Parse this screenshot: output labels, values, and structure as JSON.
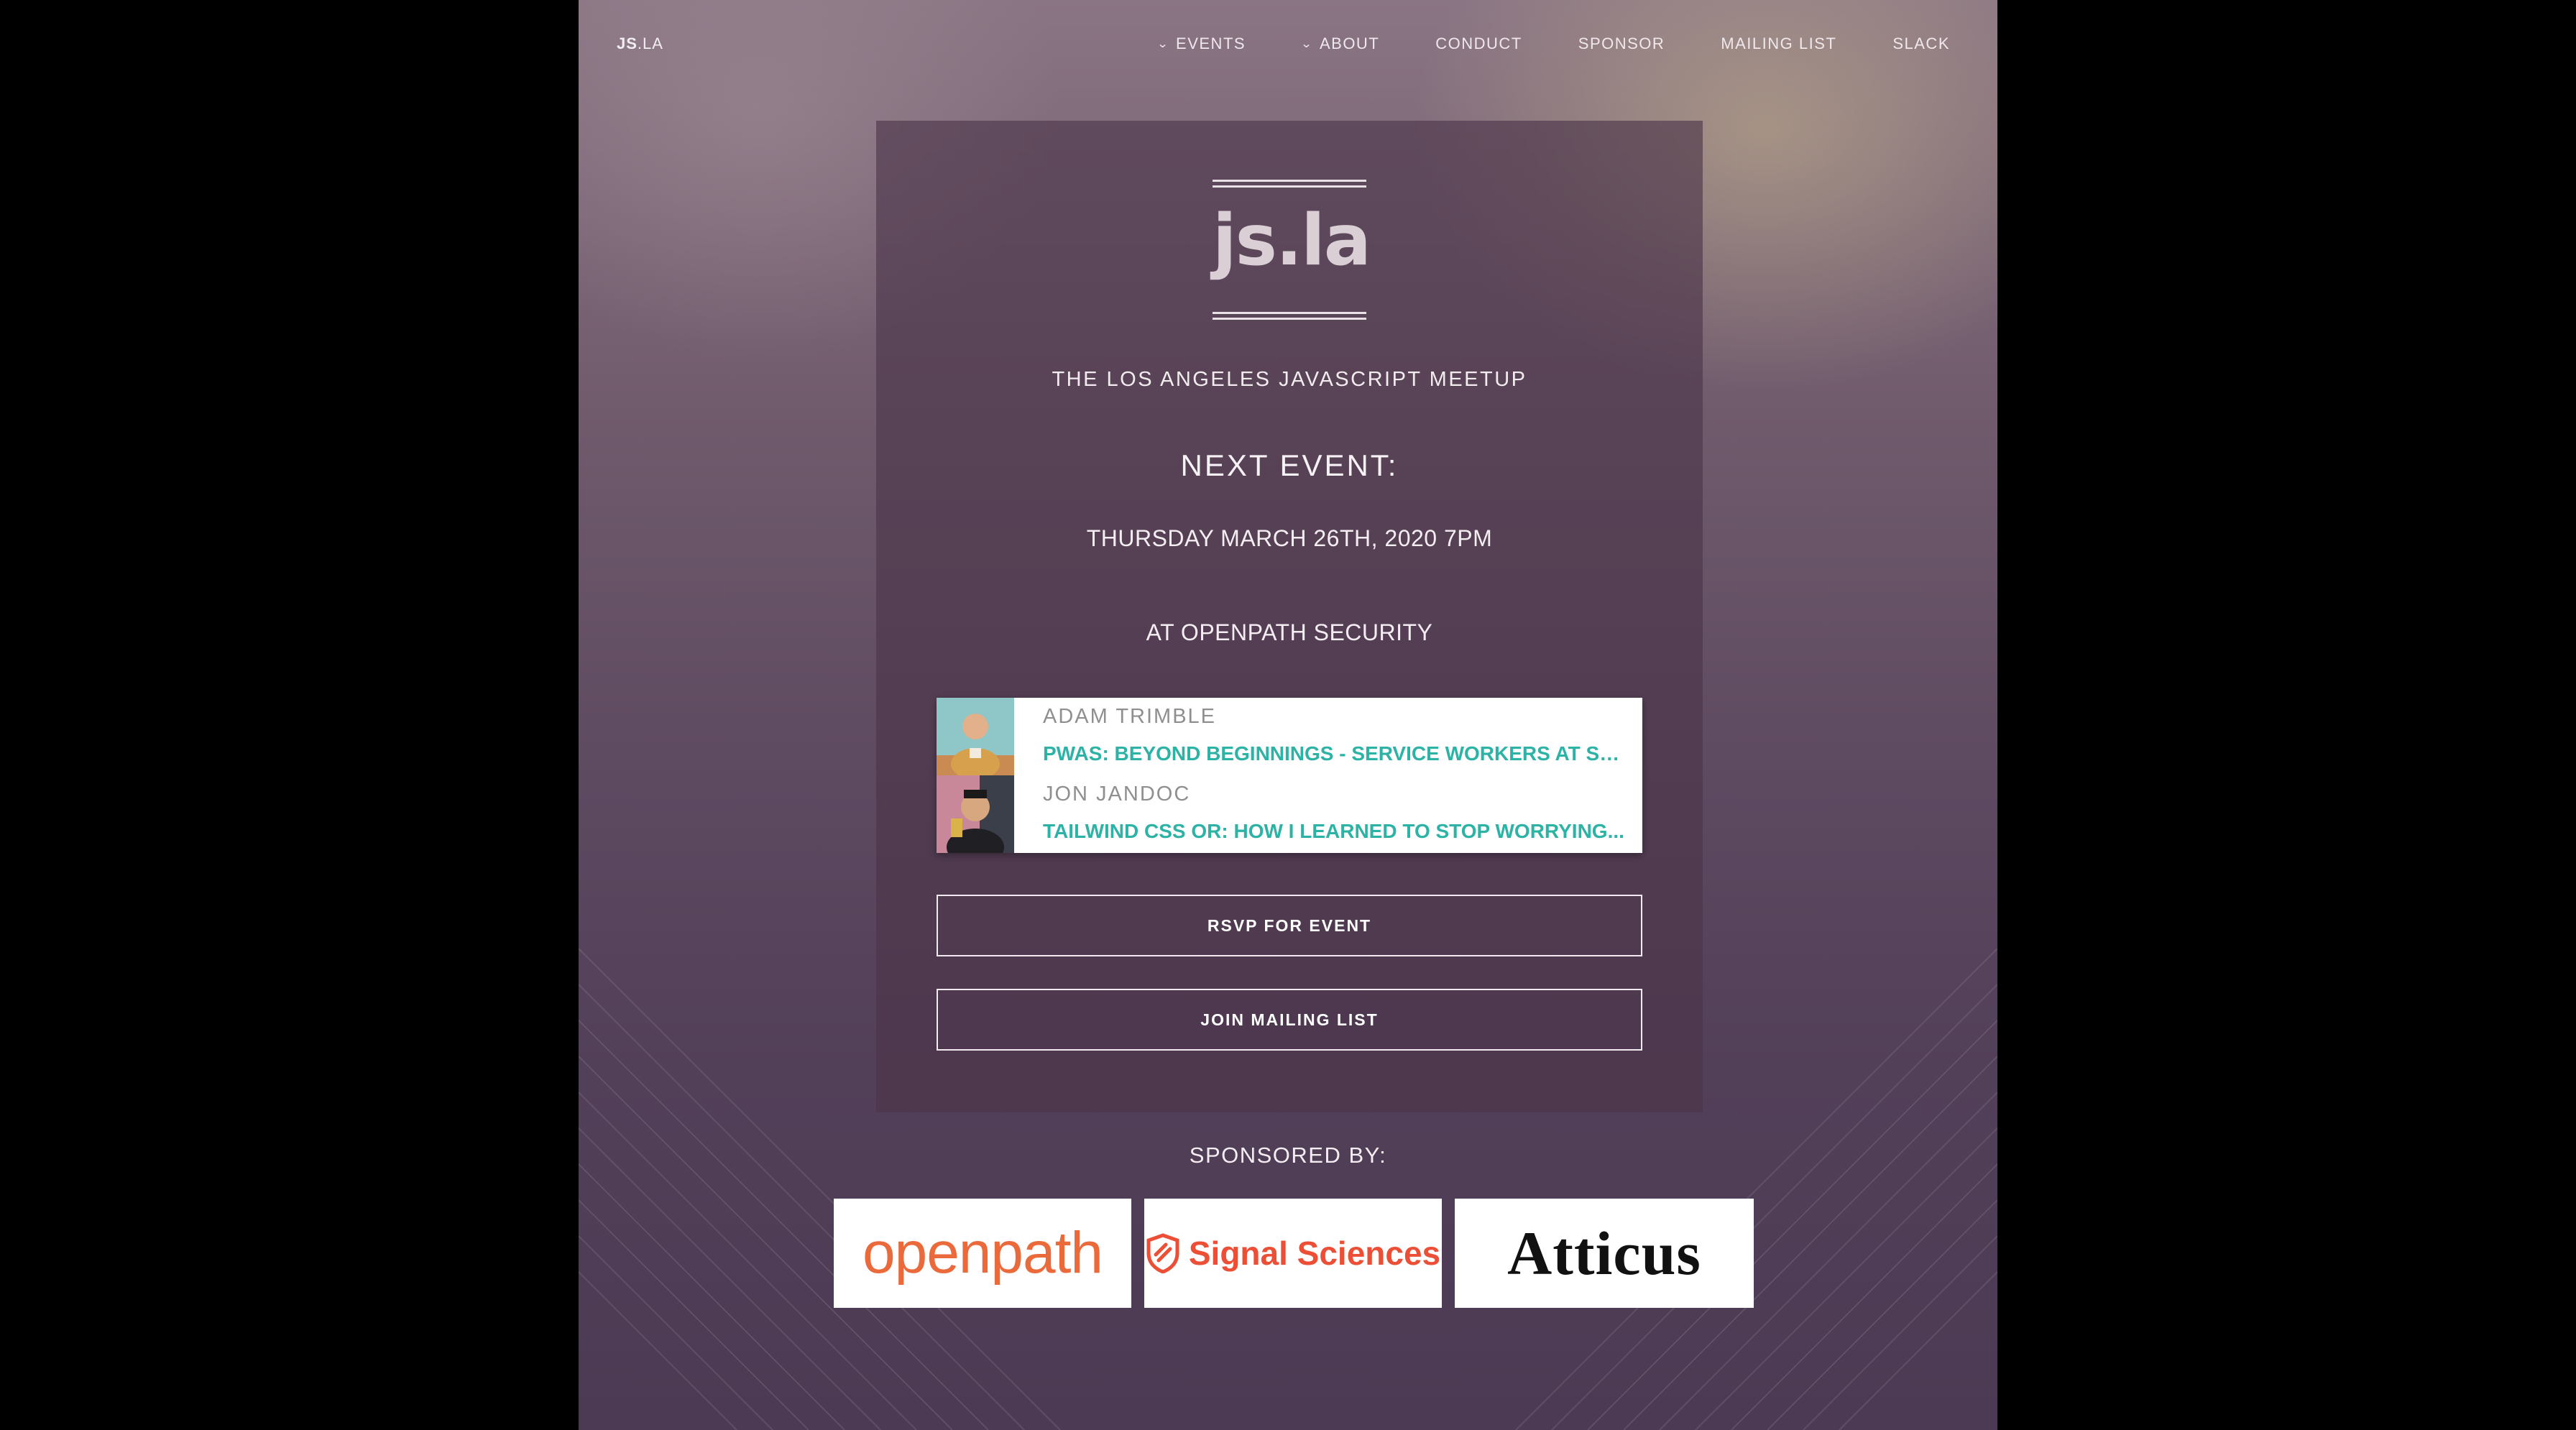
{
  "nav": {
    "logo_bold": "JS",
    "logo_rest": ".LA",
    "items": [
      {
        "label": "EVENTS",
        "has_dropdown": true
      },
      {
        "label": "ABOUT",
        "has_dropdown": true
      },
      {
        "label": "CONDUCT",
        "has_dropdown": false
      },
      {
        "label": "SPONSOR",
        "has_dropdown": false
      },
      {
        "label": "MAILING LIST",
        "has_dropdown": false
      },
      {
        "label": "SLACK",
        "has_dropdown": false
      }
    ]
  },
  "hero": {
    "logo_text": "js.la",
    "tagline": "THE LOS ANGELES JAVASCRIPT MEETUP",
    "next_event_heading": "NEXT EVENT:",
    "date": "THURSDAY MARCH 26TH, 2020 7PM",
    "venue": "AT OPENPATH SECURITY"
  },
  "talks": [
    {
      "speaker": "ADAM TRIMBLE",
      "title": "PWAS: BEYOND BEGINNINGS - SERVICE WORKERS AT SC...",
      "avatar_icon": "speaker-photo"
    },
    {
      "speaker": "JON JANDOC",
      "title": "TAILWIND CSS OR: HOW I LEARNED TO STOP WORRYING...",
      "avatar_icon": "speaker-photo"
    }
  ],
  "buttons": {
    "rsvp": "RSVP FOR EVENT",
    "mailing": "JOIN MAILING LIST"
  },
  "sponsors": {
    "heading": "SPONSORED BY:",
    "items": [
      {
        "name": "openpath"
      },
      {
        "name": "Signal Sciences"
      },
      {
        "name": "Atticus"
      }
    ]
  },
  "colors": {
    "accent_teal": "#2cb3a6",
    "openpath_orange": "#ea6a3c",
    "signal_red": "#ec4f35"
  }
}
